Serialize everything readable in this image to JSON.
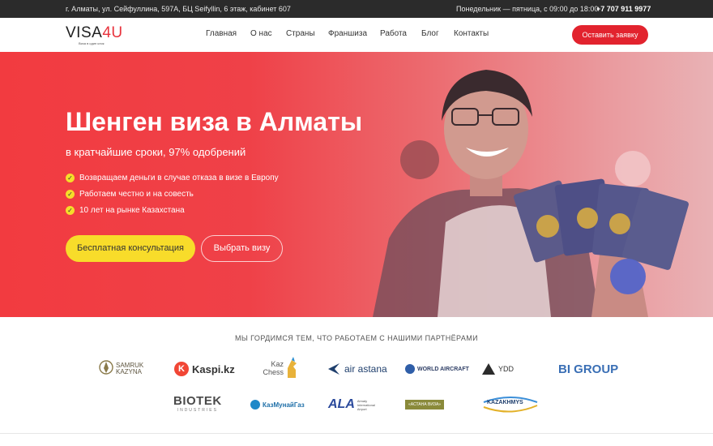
{
  "topbar": {
    "address": "г. Алматы, ул. Сейфуллина, 597А, БЦ Seifyllin, 6 этаж, кабинет 607",
    "hours": "Понедельник — пятница, с 09:00 до 18:00",
    "phone": "+7 707 911 9977"
  },
  "header": {
    "logo_text_a": "VISA",
    "logo_text_b": "4U",
    "logo_tagline": "Виза в один клик",
    "nav": [
      "Главная",
      "О нас",
      "Страны",
      "Франшиза",
      "Работа",
      "Блог",
      "Контакты"
    ],
    "cta_label": "Оставить заявку"
  },
  "hero": {
    "title": "Шенген виза в Алматы",
    "subtitle": "в кратчайшие сроки, 97% одобрений",
    "benefits": [
      "Возвращаем деньги в случае отказа в визе в Европу",
      "Работаем честно и на совесть",
      "10 лет на рынке Казахстана"
    ],
    "primary_button": "Бесплатная консультация",
    "secondary_button": "Выбрать визу"
  },
  "partners": {
    "title": "МЫ ГОРДИМСЯ ТЕМ, ЧТО РАБОТАЕМ С НАШИМИ ПАРТНЁРАМИ",
    "row1": [
      "SAMRUK KAZYNA",
      "Kaspi.kz",
      "Kaz Chess",
      "air astana",
      "WORLD AIRCRAFT",
      "YDD",
      "BI GROUP"
    ],
    "row2": [
      "BIOTEK",
      "INDUSTRIES",
      "КазМунайГаз",
      "ALA",
      "Almaty International Airport",
      "«АСТАНА ВИЗА»",
      "KAZAKHMYS"
    ]
  },
  "colors": {
    "brand_red": "#e2232e",
    "accent_yellow": "#f8dc2a",
    "topbar_bg": "#2b2b2b"
  }
}
